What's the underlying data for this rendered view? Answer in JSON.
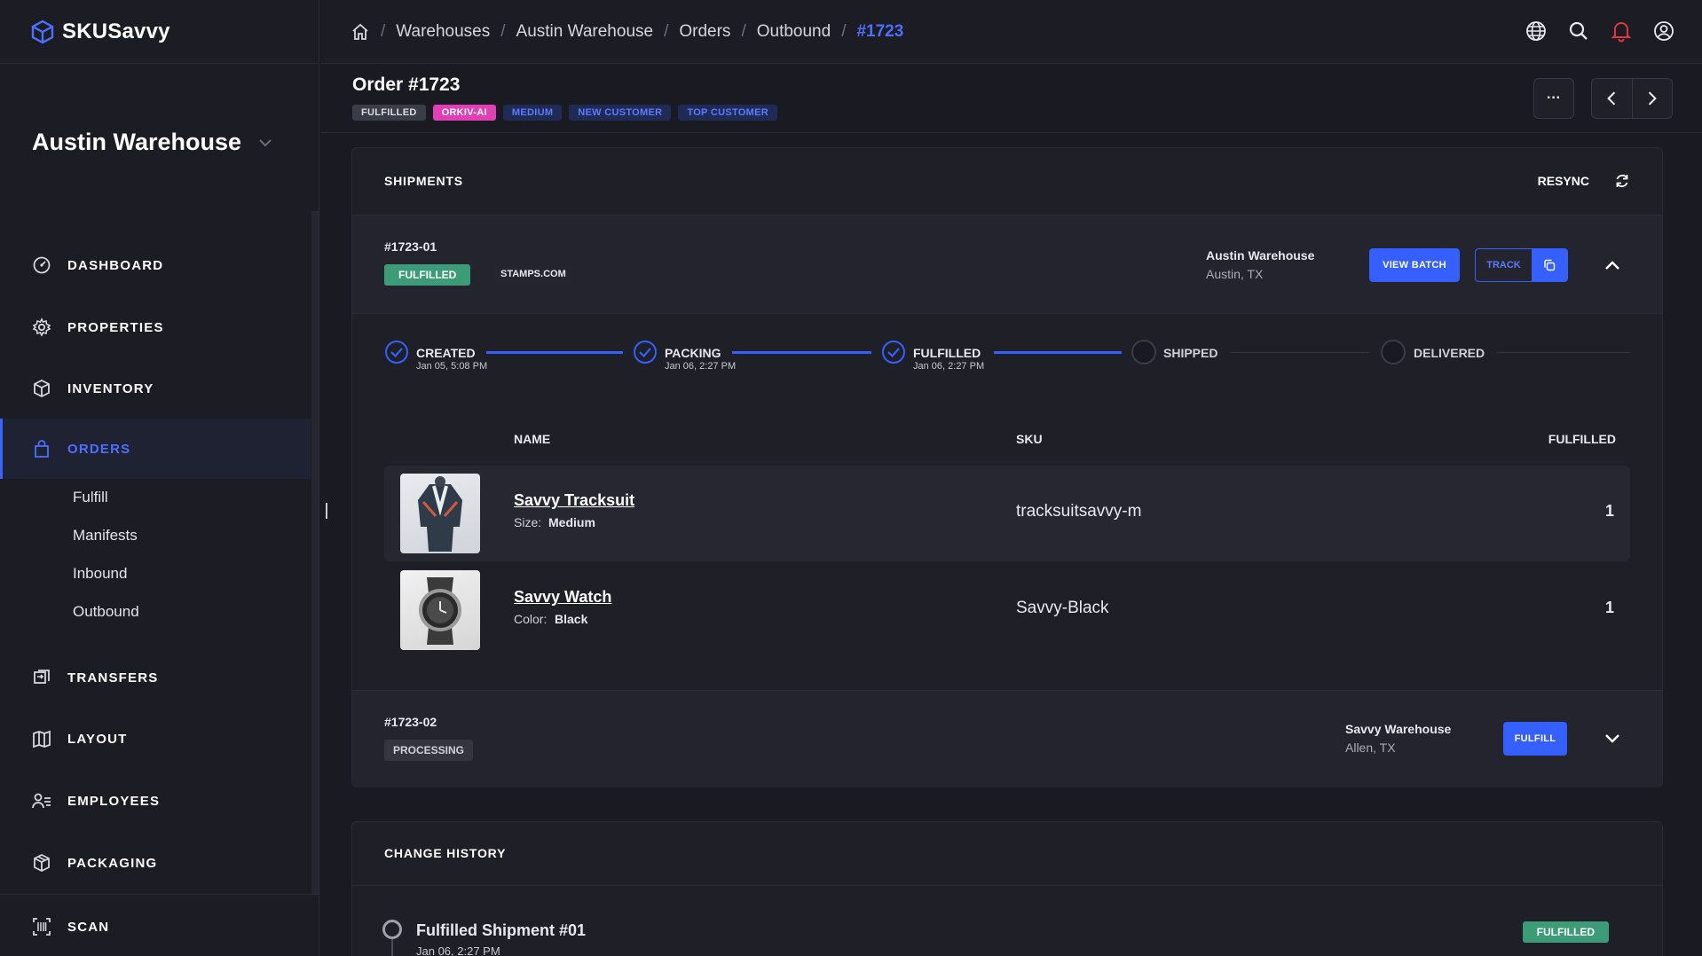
{
  "app": {
    "name": "SKUSavvy"
  },
  "sidebar": {
    "warehouse": "Austin Warehouse",
    "items": [
      {
        "label": "DASHBOARD"
      },
      {
        "label": "PROPERTIES"
      },
      {
        "label": "INVENTORY"
      },
      {
        "label": "ORDERS"
      },
      {
        "label": "TRANSFERS"
      },
      {
        "label": "LAYOUT"
      },
      {
        "label": "EMPLOYEES"
      },
      {
        "label": "PACKAGING"
      },
      {
        "label": "SCAN"
      }
    ],
    "sub_items": [
      "Fulfill",
      "Manifests",
      "Inbound",
      "Outbound"
    ]
  },
  "breadcrumb": [
    "Warehouses",
    "Austin Warehouse",
    "Orders",
    "Outbound",
    "#1723"
  ],
  "order": {
    "title": "Order #1723",
    "tags": [
      "FULFILLED",
      "ORKIV-AI",
      "MEDIUM",
      "NEW CUSTOMER",
      "TOP CUSTOMER"
    ],
    "more_label": "···"
  },
  "shipments": {
    "title": "SHIPMENTS",
    "resync_label": "RESYNC",
    "list": [
      {
        "id": "#1723-01",
        "status": "FULFILLED",
        "carrier": "STAMPS.COM",
        "warehouse": "Austin Warehouse",
        "location": "Austin, TX",
        "view_batch_label": "VIEW BATCH",
        "track_label": "TRACK",
        "steps": [
          {
            "label": "CREATED",
            "date": "Jan 05, 5:08 PM"
          },
          {
            "label": "PACKING",
            "date": "Jan 06, 2:27 PM"
          },
          {
            "label": "FULFILLED",
            "date": "Jan 06, 2:27 PM"
          },
          {
            "label": "SHIPPED",
            "date": ""
          },
          {
            "label": "DELIVERED",
            "date": ""
          }
        ],
        "columns": {
          "name": "NAME",
          "sku": "SKU",
          "fulfilled": "FULFILLED"
        },
        "items": [
          {
            "name": "Savvy Tracksuit",
            "variant_key": "Size:",
            "variant_value": "Medium",
            "sku": "tracksuitsavvy-m",
            "qty": "1"
          },
          {
            "name": "Savvy Watch",
            "variant_key": "Color:",
            "variant_value": "Black",
            "sku": "Savvy-Black",
            "qty": "1"
          }
        ]
      },
      {
        "id": "#1723-02",
        "status": "PROCESSING",
        "warehouse": "Savvy Warehouse",
        "location": "Allen, TX",
        "fulfill_label": "FULFILL"
      }
    ]
  },
  "history": {
    "title": "CHANGE HISTORY",
    "entries": [
      {
        "title": "Fulfilled Shipment #01",
        "date": "Jan 06, 2:27 PM",
        "badge": "FULFILLED"
      }
    ]
  },
  "colors": {
    "accent": "#3560ff",
    "success": "#3d9c78",
    "alert": "#e0383e"
  }
}
